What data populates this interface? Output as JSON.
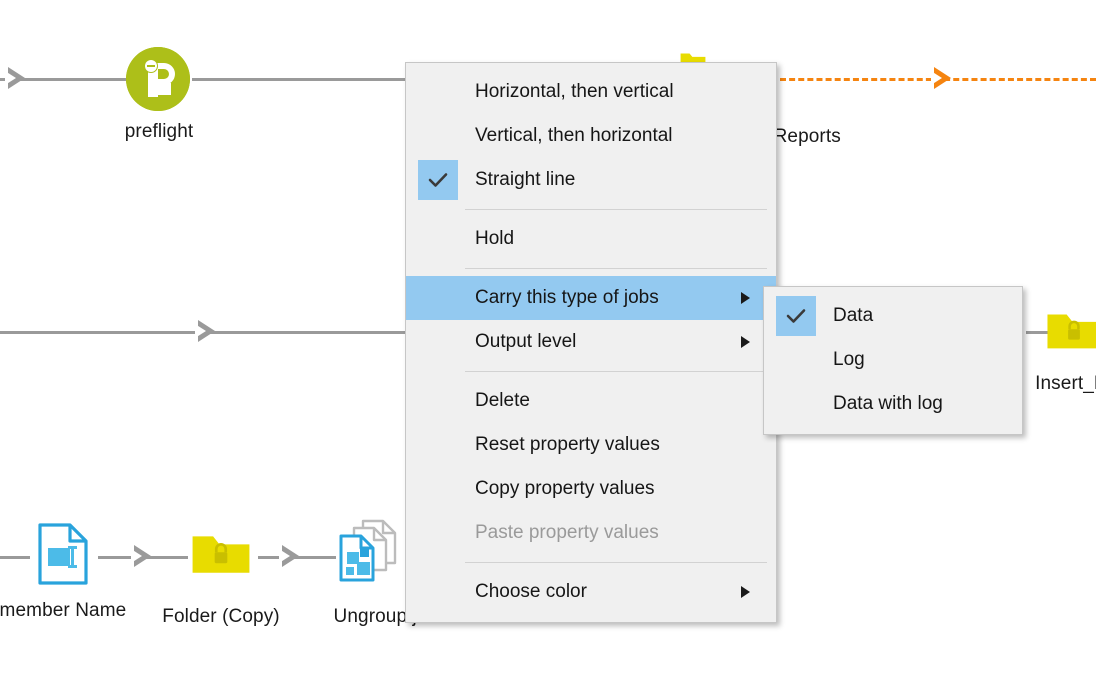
{
  "app": {
    "canvas_background": "#ffffff",
    "accent_highlight": "#93c9f0",
    "wire_color": "#9a9a9a",
    "dashed_wire_color": "#f58410",
    "folder_color": "#e8dc00",
    "preflight_color": "#adbf19",
    "node_icon_blue": "#29a3dc"
  },
  "canvas": {
    "nodes": [
      {
        "id": "preflight",
        "label": "preflight",
        "icon": "pitstop-preflight-icon"
      },
      {
        "id": "folder_top",
        "label": "",
        "icon": "folder-icon"
      },
      {
        "id": "preflight_reports",
        "label": "ght Reports",
        "icon": "folder-icon"
      },
      {
        "id": "insert_pages",
        "label": "Insert_F",
        "icon": "folder-locked-icon"
      },
      {
        "id": "remember_name",
        "label": "emember Name",
        "icon": "rename-document-icon"
      },
      {
        "id": "folder_copy",
        "label": "Folder (Copy)",
        "icon": "folder-locked-icon"
      },
      {
        "id": "ungroup_jobs",
        "label": "Ungroup j",
        "icon": "ungroup-jobs-icon"
      }
    ],
    "connections": [
      {
        "id": "wire_top",
        "style": "solid",
        "color": "#9a9a9a",
        "arrow": true
      },
      {
        "id": "wire_mid",
        "style": "solid",
        "color": "#9a9a9a",
        "arrow": true
      },
      {
        "id": "wire_bottom",
        "style": "solid",
        "color": "#9a9a9a",
        "arrow": true
      },
      {
        "id": "wire_reports",
        "style": "dashed",
        "color": "#f58410",
        "arrow": true
      }
    ]
  },
  "context_menu": {
    "items": [
      {
        "id": "horizontal-then-vertical",
        "label": "Horizontal, then vertical",
        "checked": false,
        "submenu": false,
        "disabled": false,
        "highlighted": false
      },
      {
        "id": "vertical-then-horizontal",
        "label": "Vertical, then horizontal",
        "checked": false,
        "submenu": false,
        "disabled": false,
        "highlighted": false
      },
      {
        "id": "straight-line",
        "label": "Straight line",
        "checked": true,
        "submenu": false,
        "disabled": false,
        "highlighted": false
      },
      {
        "id": "separator-1",
        "label": "",
        "separator": true
      },
      {
        "id": "hold",
        "label": "Hold",
        "checked": false,
        "submenu": false,
        "disabled": false,
        "highlighted": false
      },
      {
        "id": "separator-2",
        "label": "",
        "separator": true
      },
      {
        "id": "carry-this-type-of-jobs",
        "label": "Carry this type of jobs",
        "checked": false,
        "submenu": true,
        "disabled": false,
        "highlighted": true
      },
      {
        "id": "output-level",
        "label": "Output level",
        "checked": false,
        "submenu": true,
        "disabled": false,
        "highlighted": false
      },
      {
        "id": "separator-3",
        "label": "",
        "separator": true
      },
      {
        "id": "delete",
        "label": "Delete",
        "checked": false,
        "submenu": false,
        "disabled": false,
        "highlighted": false
      },
      {
        "id": "reset-property-values",
        "label": "Reset property values",
        "checked": false,
        "submenu": false,
        "disabled": false,
        "highlighted": false
      },
      {
        "id": "copy-property-values",
        "label": "Copy property values",
        "checked": false,
        "submenu": false,
        "disabled": false,
        "highlighted": false
      },
      {
        "id": "paste-property-values",
        "label": "Paste property values",
        "checked": false,
        "submenu": false,
        "disabled": true,
        "highlighted": false
      },
      {
        "id": "separator-4",
        "label": "",
        "separator": true
      },
      {
        "id": "choose-color",
        "label": "Choose color",
        "checked": false,
        "submenu": true,
        "disabled": false,
        "highlighted": false
      }
    ]
  },
  "submenu": {
    "parent": "Carry this type of jobs",
    "items": [
      {
        "id": "data",
        "label": "Data",
        "checked": true
      },
      {
        "id": "log",
        "label": "Log",
        "checked": false
      },
      {
        "id": "data-with-log",
        "label": "Data with log",
        "checked": false
      }
    ]
  }
}
